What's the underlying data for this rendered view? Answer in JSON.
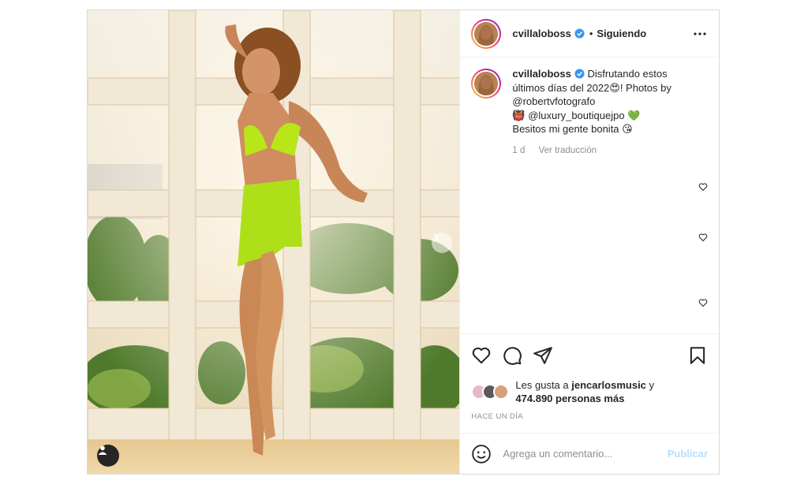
{
  "header": {
    "username": "cvillaloboss",
    "separator": "•",
    "follow_status": "Siguiendo"
  },
  "caption": {
    "username": "cvillaloboss",
    "line1": "Disfrutando estos últimos días del 2022",
    "line1_emoji": "😍",
    "line1_tail": "! Photos by",
    "mention1": "@robertvfotografo",
    "line3_emoji": "👹",
    "mention2": "@luxury_boutiquejpo",
    "line3_heart": "💚",
    "line4": "Besitos mi gente bonita",
    "line4_emoji": "😘",
    "age": "1 d",
    "translate": "Ver traducción"
  },
  "likes": {
    "prefix": "Les gusta a",
    "user": "jencarlosmusic",
    "middle": "y",
    "count": "474.890 personas más"
  },
  "timestamp": "HACE UN DÍA",
  "comment_box": {
    "placeholder": "Agrega un comentario...",
    "post_label": "Publicar"
  },
  "icons": {
    "verified": "verified-badge-icon",
    "more": "more-options-icon",
    "like": "heart-icon",
    "comment": "comment-icon",
    "share": "paper-plane-icon",
    "save": "bookmark-icon",
    "emoji": "smiley-icon",
    "next": "chevron-right-icon",
    "tag": "user-tag-icon"
  },
  "colors": {
    "accent": "#0095f6",
    "verified": "#3897f0",
    "publish_disabled": "#b2dffc",
    "muted": "#8e8e8e"
  }
}
